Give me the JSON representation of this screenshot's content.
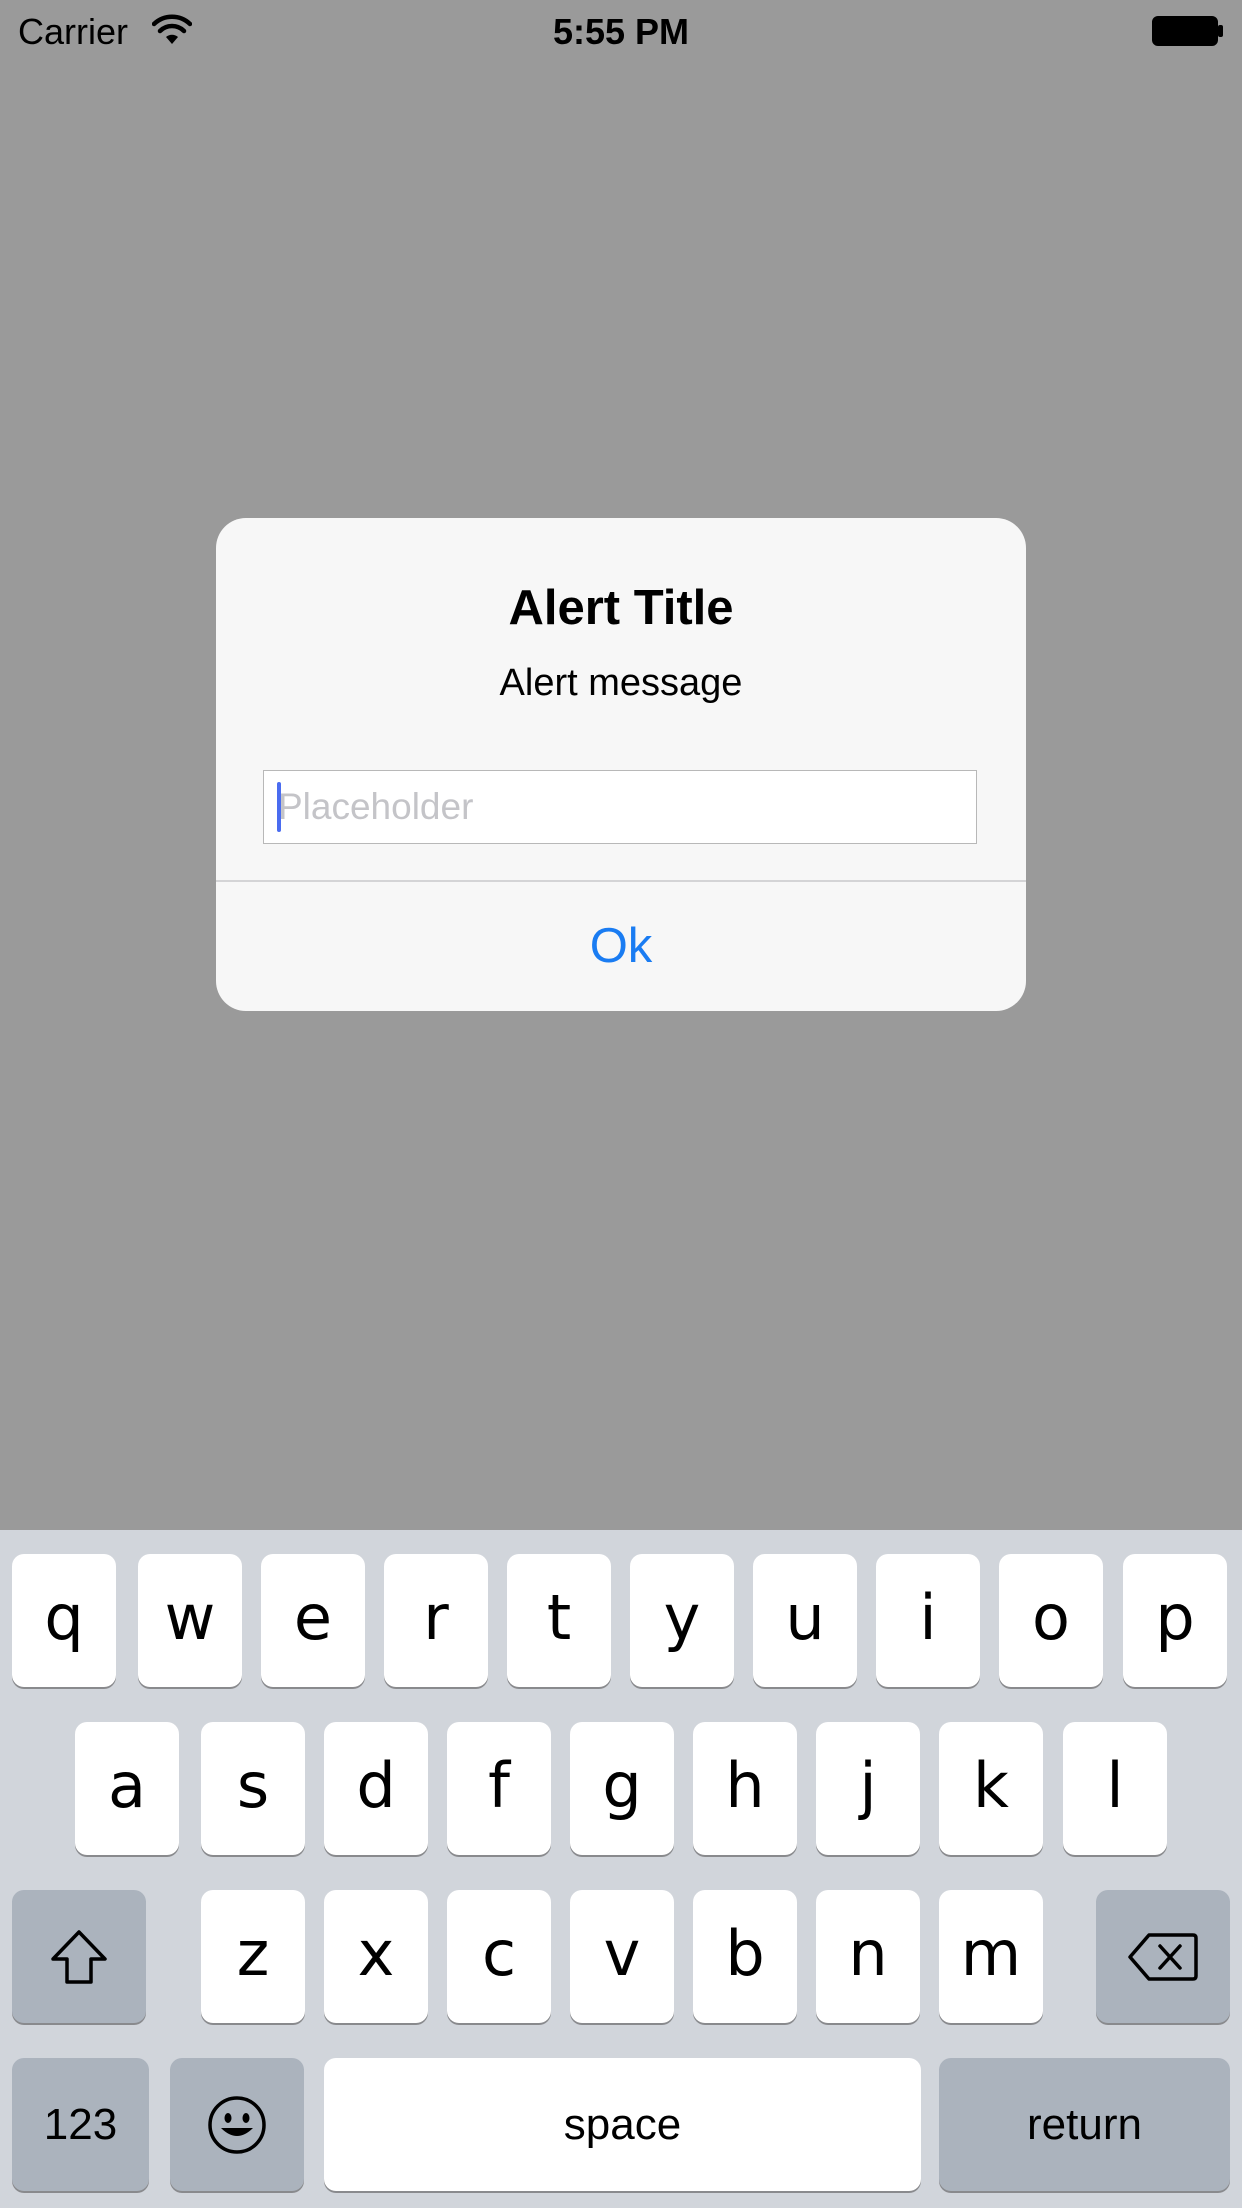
{
  "status_bar": {
    "carrier": "Carrier",
    "time": "5:55 PM"
  },
  "alert": {
    "title": "Alert Title",
    "message": "Alert message",
    "input_placeholder": "Placeholder",
    "input_value": "",
    "ok_label": "Ok"
  },
  "keyboard": {
    "row1": [
      "q",
      "w",
      "e",
      "r",
      "t",
      "y",
      "u",
      "i",
      "o",
      "p"
    ],
    "row2": [
      "a",
      "s",
      "d",
      "f",
      "g",
      "h",
      "j",
      "k",
      "l"
    ],
    "row3": [
      "z",
      "x",
      "c",
      "v",
      "b",
      "n",
      "m"
    ],
    "numbers_label": "123",
    "space_label": "space",
    "return_label": "return"
  },
  "colors": {
    "backdrop": "#9a9a9a",
    "alert_bg": "#f7f7f7",
    "accent_blue": "#1a7cf2",
    "keyboard_bg": "#d1d5db",
    "special_key_bg": "#abb3bd"
  },
  "icons": {
    "wifi": "wifi-icon",
    "battery": "battery-icon",
    "shift": "shift-icon",
    "backspace": "backspace-icon",
    "emoji": "emoji-icon"
  }
}
